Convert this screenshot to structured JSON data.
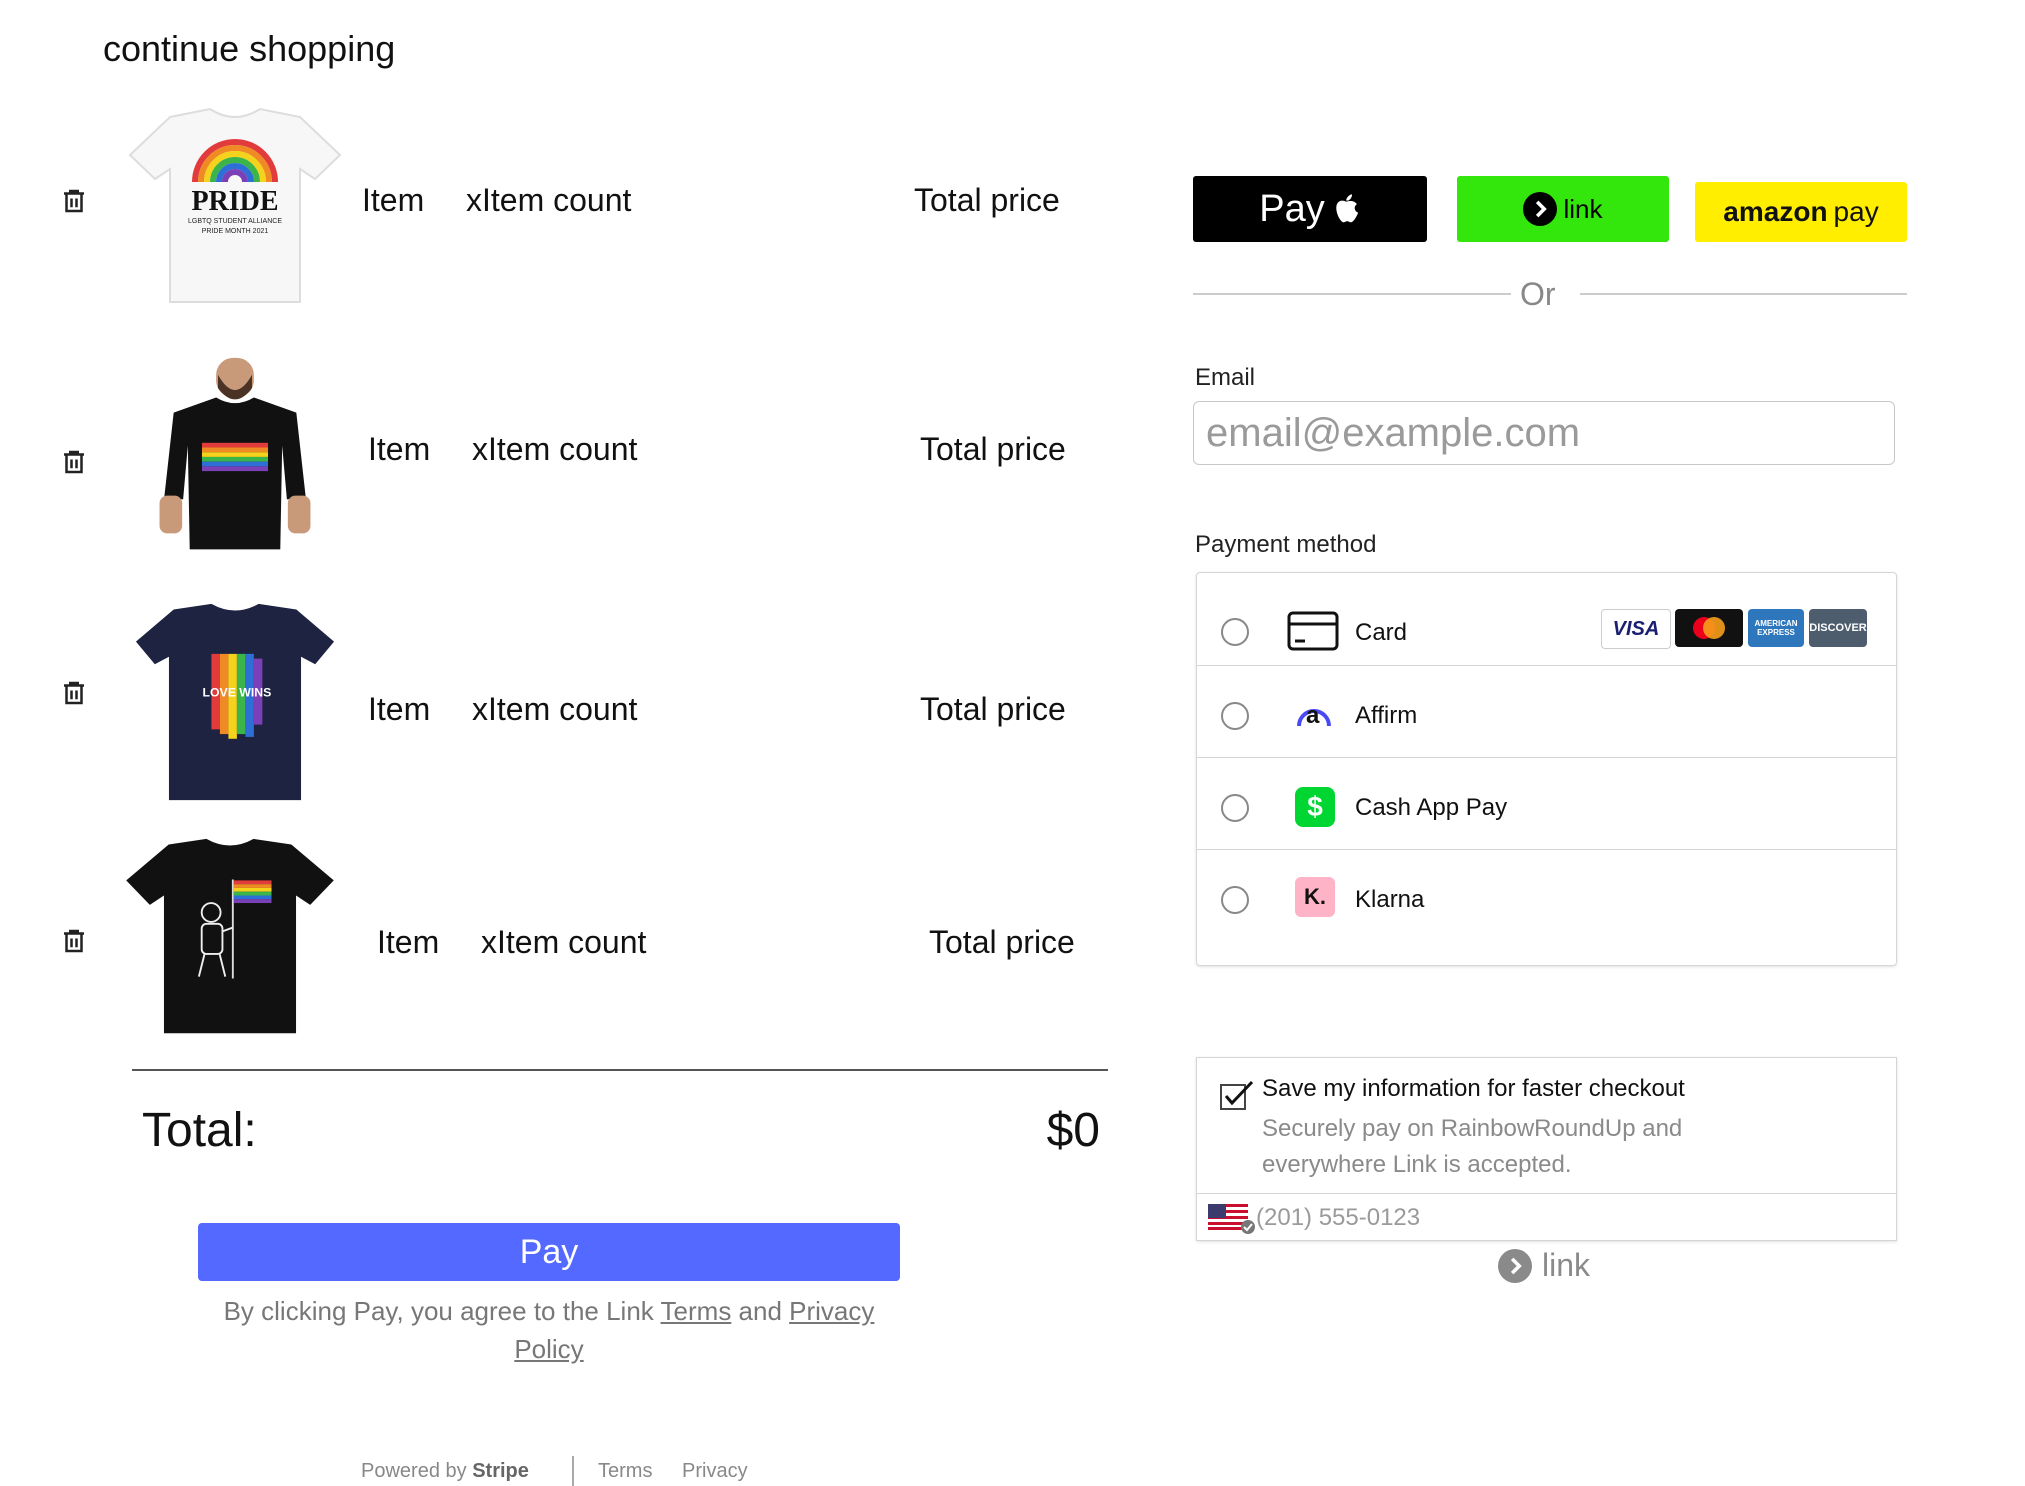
{
  "header": {
    "continue_label": "continue shopping"
  },
  "cart": {
    "items": [
      {
        "name": "Item",
        "count": "xItem count",
        "total": "Total price",
        "product": "white-pride-tshirt"
      },
      {
        "name": "Item",
        "count": "xItem count",
        "total": "Total price",
        "product": "man-black-pride-tshirt"
      },
      {
        "name": "Item",
        "count": "xItem count",
        "total": "Total price",
        "product": "navy-love-wins-tshirt"
      },
      {
        "name": "Item",
        "count": "xItem count",
        "total": "Total price",
        "product": "black-astronaut-flag-tshirt"
      }
    ],
    "pride_text": "PRIDE",
    "pride_sub": "LGBTQ STUDENT ALLIANCE",
    "pride_sub2": "PRIDE MONTH 2021",
    "love_wins": "LOVE WINS",
    "total_label": "Total:",
    "total_value": "$0",
    "pay_label": "Pay",
    "consent_prefix": "By clicking Pay, you agree to the Link ",
    "consent_terms": "Terms",
    "consent_and": " and ",
    "consent_privacy": "Privacy Policy"
  },
  "footer": {
    "powered_by": "Powered by",
    "stripe": "Stripe",
    "terms": "Terms",
    "privacy": "Privacy"
  },
  "express": {
    "apple_pay": "Pay",
    "link": "link",
    "amazon_brand": "amazon",
    "amazon_pay": "pay",
    "or": "Or"
  },
  "email": {
    "label": "Email",
    "placeholder": "email@example.com"
  },
  "payment": {
    "label": "Payment method",
    "methods": [
      {
        "label": "Card",
        "icon": "credit-card-icon"
      },
      {
        "label": "Affirm",
        "icon": "affirm-icon"
      },
      {
        "label": "Cash App Pay",
        "icon": "cash-app-icon"
      },
      {
        "label": "Klarna",
        "icon": "klarna-icon"
      }
    ],
    "card_brands": [
      "VISA",
      "Mastercard",
      "AMERICAN EXPRESS",
      "DISCOVER"
    ],
    "affirm_glyph": "a",
    "cash_glyph": "$",
    "klarna_glyph": "K."
  },
  "link_save": {
    "checked": true,
    "title": "Save my information for faster checkout",
    "subtitle": "Securely pay on RainbowRoundUp and everywhere Link is accepted.",
    "phone_placeholder": "(201) 555-0123",
    "link_label": "link"
  },
  "colors": {
    "pay_button": "#5469ff",
    "link_green": "#33e60c",
    "amazon_yellow": "#ffee00",
    "cash_app_green": "#00d632",
    "klarna_pink": "#ffb3c7"
  }
}
